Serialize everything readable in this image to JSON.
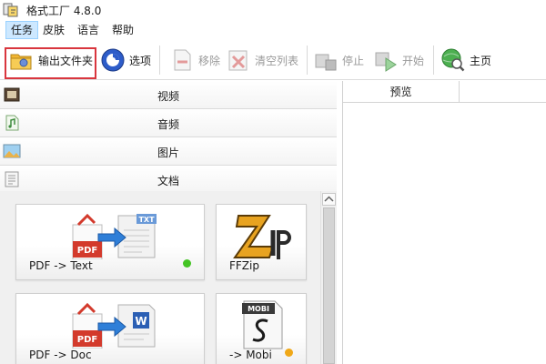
{
  "window": {
    "title": "格式工厂 4.8.0"
  },
  "menu": {
    "items": [
      {
        "label": "任务",
        "active": true
      },
      {
        "label": "皮肤"
      },
      {
        "label": "语言"
      },
      {
        "label": "帮助"
      }
    ]
  },
  "toolbar": {
    "output_folder": "输出文件夹",
    "options": "选项",
    "remove": "移除",
    "clear_list": "清空列表",
    "stop": "停止",
    "start": "开始",
    "home": "主页"
  },
  "categories": [
    {
      "label": "视频",
      "icon": "video-icon"
    },
    {
      "label": "音频",
      "icon": "audio-icon"
    },
    {
      "label": "图片",
      "icon": "picture-icon"
    },
    {
      "label": "文档",
      "icon": "document-icon"
    }
  ],
  "cards": [
    {
      "label": "PDF -> Text",
      "icon": "pdf-to-text-icon",
      "status_color": "#44c424"
    },
    {
      "label": "FFZip",
      "icon": "ffzip-icon"
    },
    {
      "label": "PDF -> Doc",
      "icon": "pdf-to-doc-icon"
    },
    {
      "label": "-> Mobi",
      "icon": "mobi-icon",
      "status_color": "#f0a818"
    }
  ],
  "preview": {
    "header": "预览"
  },
  "colors": {
    "highlight": "#d9363e",
    "menu_active": "#cde8ff",
    "pdf_red": "#d33a2c"
  }
}
